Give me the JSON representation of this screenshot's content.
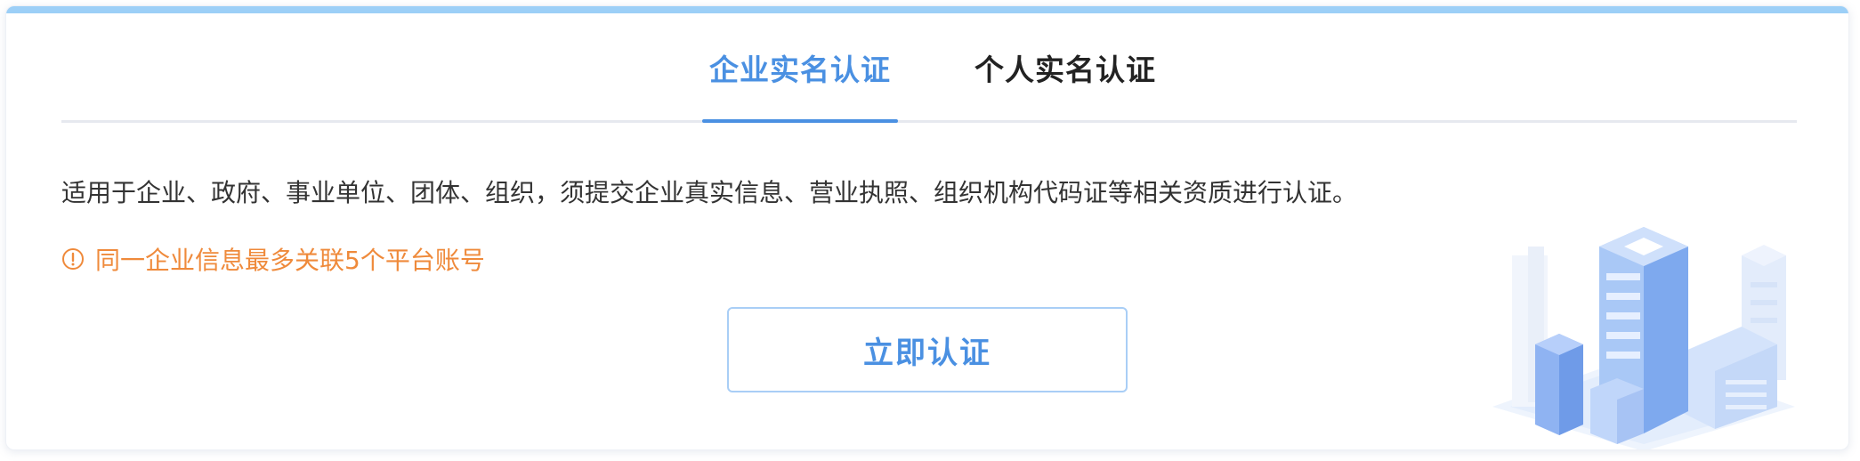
{
  "tabs": {
    "active_label": "企业实名认证",
    "inactive_label": "个人实名认证"
  },
  "content": {
    "description": "适用于企业、政府、事业单位、团体、组织，须提交企业真实信息、营业执照、组织机构代码证等相关资质进行认证。",
    "notice": "同一企业信息最多关联5个平台账号",
    "notice_icon": "exclamation-circle-icon",
    "verify_button_label": "立即认证",
    "illustration": "building-illustration"
  },
  "colors": {
    "accent_blue": "#4a90e2",
    "top_bar": "#9ccff7",
    "tab_inactive": "#222222",
    "notice_orange": "#ef8a3b",
    "text": "#333333"
  }
}
